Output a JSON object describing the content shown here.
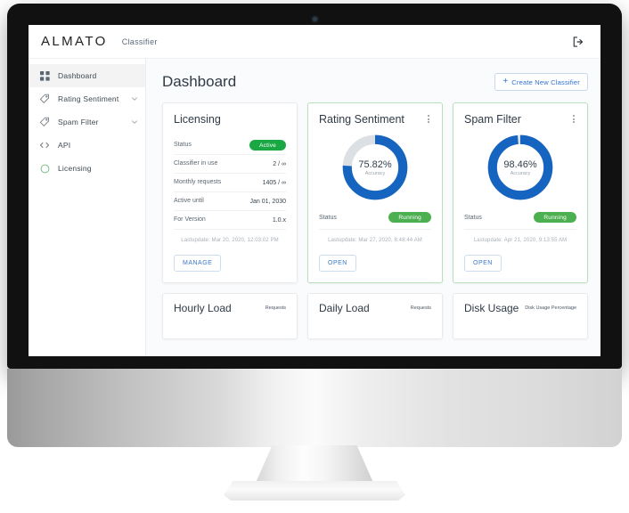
{
  "app": {
    "brand": "ALMATO",
    "product": "Classifier",
    "logout_icon": "logout-icon"
  },
  "sidebar": {
    "items": [
      {
        "label": "Dashboard",
        "icon": "grid-icon",
        "active": true,
        "chevron": false
      },
      {
        "label": "Rating Sentiment",
        "icon": "tag-icon",
        "active": false,
        "chevron": true
      },
      {
        "label": "Spam Filter",
        "icon": "tag-icon",
        "active": false,
        "chevron": true
      },
      {
        "label": "API",
        "icon": "code-icon",
        "active": false,
        "chevron": false
      },
      {
        "label": "Licensing",
        "icon": "circle-icon",
        "active": false,
        "chevron": false
      }
    ]
  },
  "main": {
    "title": "Dashboard",
    "create_button": {
      "label": "Create New Classifier",
      "icon": "plus-icon"
    }
  },
  "licensing_card": {
    "title": "Licensing",
    "rows": [
      {
        "label": "Status",
        "value": "Active",
        "is_badge": true
      },
      {
        "label": "Classifier in use",
        "value": "2 / ∞",
        "is_badge": false
      },
      {
        "label": "Monthly requests",
        "value": "1405 / ∞",
        "is_badge": false
      },
      {
        "label": "Active until",
        "value": "Jan 01, 2030",
        "is_badge": false
      },
      {
        "label": "For Version",
        "value": "1.0.x",
        "is_badge": false
      }
    ],
    "last_update": "Lastupdate: Mar 20, 2020, 12:03:02 PM",
    "action_label": "MANAGE"
  },
  "classifier_cards": [
    {
      "title": "Rating Sentiment",
      "accuracy_value": "75.82%",
      "accuracy_percent": 75.82,
      "accuracy_caption": "Accuracy",
      "status_label": "Status",
      "status_value": "Running",
      "last_update": "Lastupdate: Mar 27, 2020, 8:48:44 AM",
      "action_label": "OPEN"
    },
    {
      "title": "Spam Filter",
      "accuracy_value": "98.46%",
      "accuracy_percent": 98.46,
      "accuracy_caption": "Accuracy",
      "status_label": "Status",
      "status_value": "Running",
      "last_update": "Lastupdate: Apr 21, 2020, 9:13:55 AM",
      "action_label": "OPEN"
    }
  ],
  "mini_cards": [
    {
      "title": "Hourly Load",
      "legend": "Requests"
    },
    {
      "title": "Daily Load",
      "legend": "Requests"
    },
    {
      "title": "Disk Usage",
      "legend": "Disk Usage Percentage"
    }
  ],
  "colors": {
    "donut_fill": "#1565c0",
    "donut_track": "#dcdfe3",
    "badge_green": "#4caf50",
    "badge_active_green": "#19a844",
    "accent_blue": "#2f6fd0",
    "card_accent_border": "#b9e0bd"
  },
  "chart_data": [
    {
      "type": "pie",
      "title": "Rating Sentiment",
      "categories": [
        "Accuracy",
        "Remaining"
      ],
      "values": [
        75.82,
        24.18
      ],
      "unit": "%",
      "center_label": "75.82%",
      "center_sublabel": "Accuracy",
      "colors": [
        "#1565c0",
        "#dcdfe3"
      ],
      "legend": false,
      "grid": false
    },
    {
      "type": "pie",
      "title": "Spam Filter",
      "categories": [
        "Accuracy",
        "Remaining"
      ],
      "values": [
        98.46,
        1.54
      ],
      "unit": "%",
      "center_label": "98.46%",
      "center_sublabel": "Accuracy",
      "colors": [
        "#1565c0",
        "#dcdfe3"
      ],
      "legend": false,
      "grid": false
    }
  ]
}
